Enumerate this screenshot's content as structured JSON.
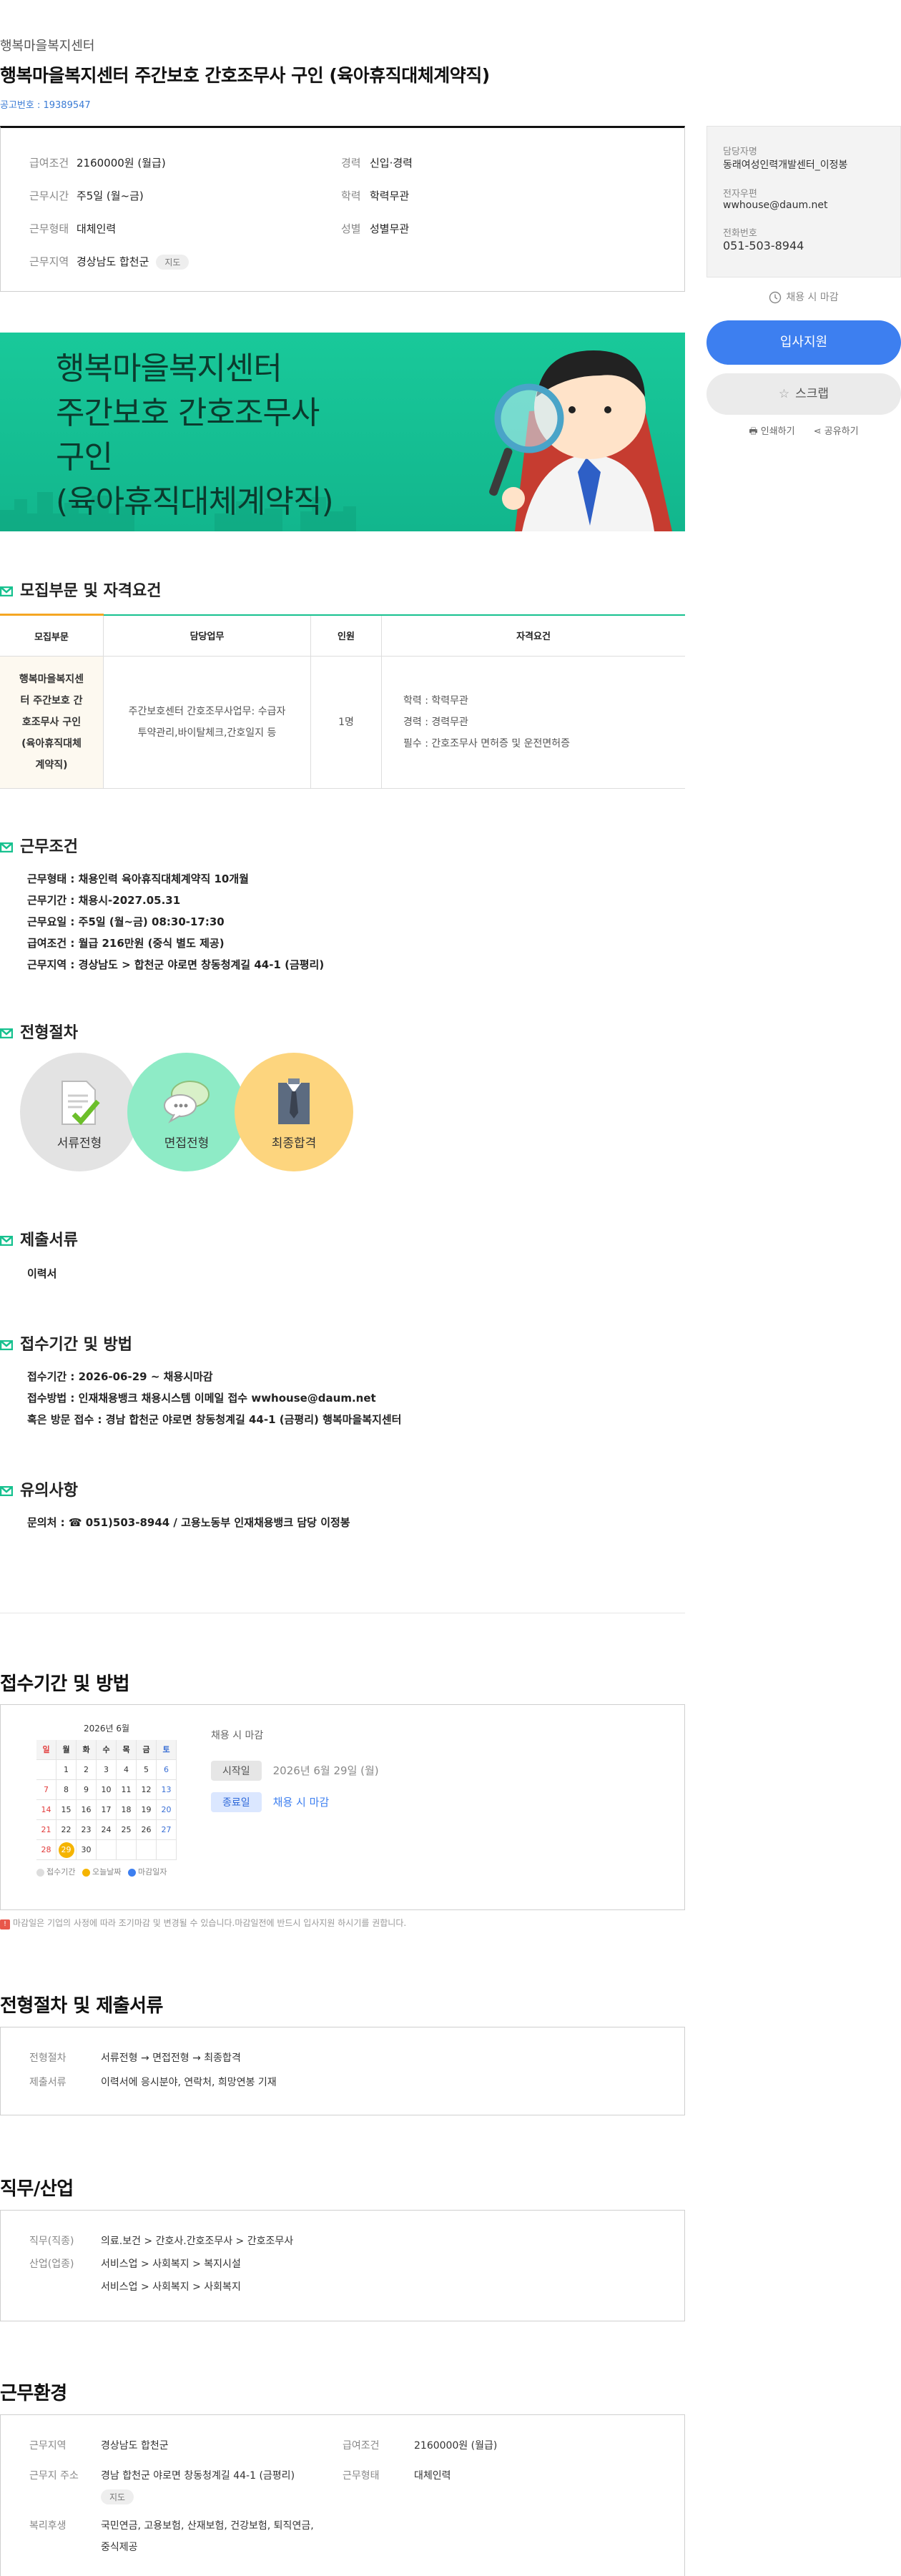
{
  "header": {
    "company": "행복마을복지센터",
    "title": "행복마을복지센터 주간보호 간호조무사 구인 (육아휴직대체계약직)",
    "notice_no": "공고번호 : 19389547"
  },
  "summary": {
    "salary_label": "급여조건",
    "salary": "2160000원 (월급)",
    "career_label": "경력",
    "career": "신입·경력",
    "hours_label": "근무시간",
    "hours": "주5일 (월~금)",
    "edu_label": "학력",
    "edu": "학력무관",
    "type_label": "근무형태",
    "type": "대체인력",
    "gender_label": "성별",
    "gender": "성별무관",
    "area_label": "근무지역",
    "area": "경상남도 합천군",
    "map_label": "지도"
  },
  "side": {
    "manager_label": "담당자명",
    "manager": "동래여성인력개발센터_이정봉",
    "email_label": "전자우편",
    "email": "wwhouse@daum.net",
    "phone_label": "전화번호",
    "phone": "051-503-8944",
    "deadline": "채용 시 마감",
    "apply": "입사지원",
    "scrap": "스크랩",
    "print": "인쇄하기",
    "share": "공유하기"
  },
  "banner": {
    "lines": [
      "행복마을복지센터",
      "주간보호 간호조무사",
      "구인",
      "(육아휴직대체계약직)"
    ]
  },
  "recruit": {
    "heading": "모집부문 및 자격요건",
    "headers": [
      "모집부문",
      "담당업무",
      "인원",
      "자격요건"
    ],
    "category": "행복마을복지센터 주간보호 간호조무사 구인 (육아휴직대체계약직)",
    "duty": "주간보호센터 간호조무사업무: 수급자 투약관리,바이탈체크,간호일지 등",
    "count": "1명",
    "reqs": [
      "학력 : 학력무관",
      "경력 : 경력무관",
      "필수 : 간호조무사 면허증 및 운전면허증"
    ]
  },
  "conditions": {
    "heading": "근무조건",
    "items": [
      "근무형태 : 채용인력 육아휴직대체계약직 10개월",
      "근무기간 : 채용시-2027.05.31",
      "근무요일 : 주5일 (월~금) 08:30-17:30",
      "급여조건 : 월급 216만원 (중식 별도 제공)",
      "근무지역 : 경상남도 > 합천군 야로면 창동청계길 44-1 (금평리)"
    ]
  },
  "process": {
    "heading": "전형절차",
    "steps": [
      "서류전형",
      "면접전형",
      "최종합격"
    ]
  },
  "docs": {
    "heading": "제출서류",
    "item": "이력서"
  },
  "apply_method": {
    "heading": "접수기간 및 방법",
    "items": [
      "접수기간 : 2026-06-29 ~ 채용시마감",
      "접수방법 : 인재채용뱅크 채용시스템 이메일 접수 wwhouse@daum.net",
      "혹은 방문 접수 : 경남 합천군 야로면 창동청계길 44-1 (금평리) 행복마을복지센터"
    ]
  },
  "caution": {
    "heading": "유의사항",
    "item": "문의처 : ☎ 051)503-8944 / 고용노동부 인재채용뱅크 담당 이정봉"
  },
  "period": {
    "heading": "접수기간 및 방법",
    "cal_title": "2026년 6월",
    "weekdays": [
      "일",
      "월",
      "화",
      "수",
      "목",
      "금",
      "토"
    ],
    "days": [
      "",
      "1",
      "2",
      "3",
      "4",
      "5",
      "6",
      "7",
      "8",
      "9",
      "10",
      "11",
      "12",
      "13",
      "14",
      "15",
      "16",
      "17",
      "18",
      "19",
      "20",
      "21",
      "22",
      "23",
      "24",
      "25",
      "26",
      "27",
      "28",
      "29",
      "30",
      "",
      "",
      "",
      ""
    ],
    "legend": [
      "접수기간",
      "오늘날짜",
      "마감일자"
    ],
    "close_text": "채용 시 마감",
    "start_tag": "시작일",
    "start_val": "2026년 6월 29일 (월)",
    "end_tag": "종료일",
    "end_val": "채용 시 마감",
    "note": "마감일은 기업의 사정에 따라 조기마감 및 변경될 수 있습니다.마감일전에 반드시 입사지원 하시기를 권합니다."
  },
  "process_docs": {
    "heading": "전형절차 및 제출서류",
    "proc_label": "전형절차",
    "proc_val": "서류전형 → 면접전형 → 최종합격",
    "docs_label": "제출서류",
    "docs_val": "이력서에 응시분야, 연락처, 희망연봉 기재"
  },
  "job": {
    "heading": "직무/산업",
    "duty_label": "직무(직종)",
    "duty_val": "의료.보건 > 간호사.간호조무사 > 간호조무사",
    "ind_label": "산업(업종)",
    "ind_vals": [
      "서비스업 > 사회복지 > 복지시설",
      "서비스업 > 사회복지 > 사회복지"
    ]
  },
  "env": {
    "heading": "근무환경",
    "area_label": "근무지역",
    "area_val": "경상남도 합천군",
    "salary_label": "급여조건",
    "salary_val": "2160000원 (월급)",
    "addr_label": "근무지 주소",
    "addr_val": "경남 합천군 야로면 창동청계길 44-1 (금평리)",
    "map_label": "지도",
    "type_label": "근무형태",
    "type_val": "대체인력",
    "welfare_label": "복리후생",
    "welfare_val1": "국민연금, 고용보험, 산재보험, 건강보험, 퇴직연금,",
    "welfare_val2": "중식제공"
  },
  "colors": {
    "accent_green": "#17c18f",
    "primary_blue": "#3d7ff0",
    "today_yellow": "#f5b400"
  }
}
